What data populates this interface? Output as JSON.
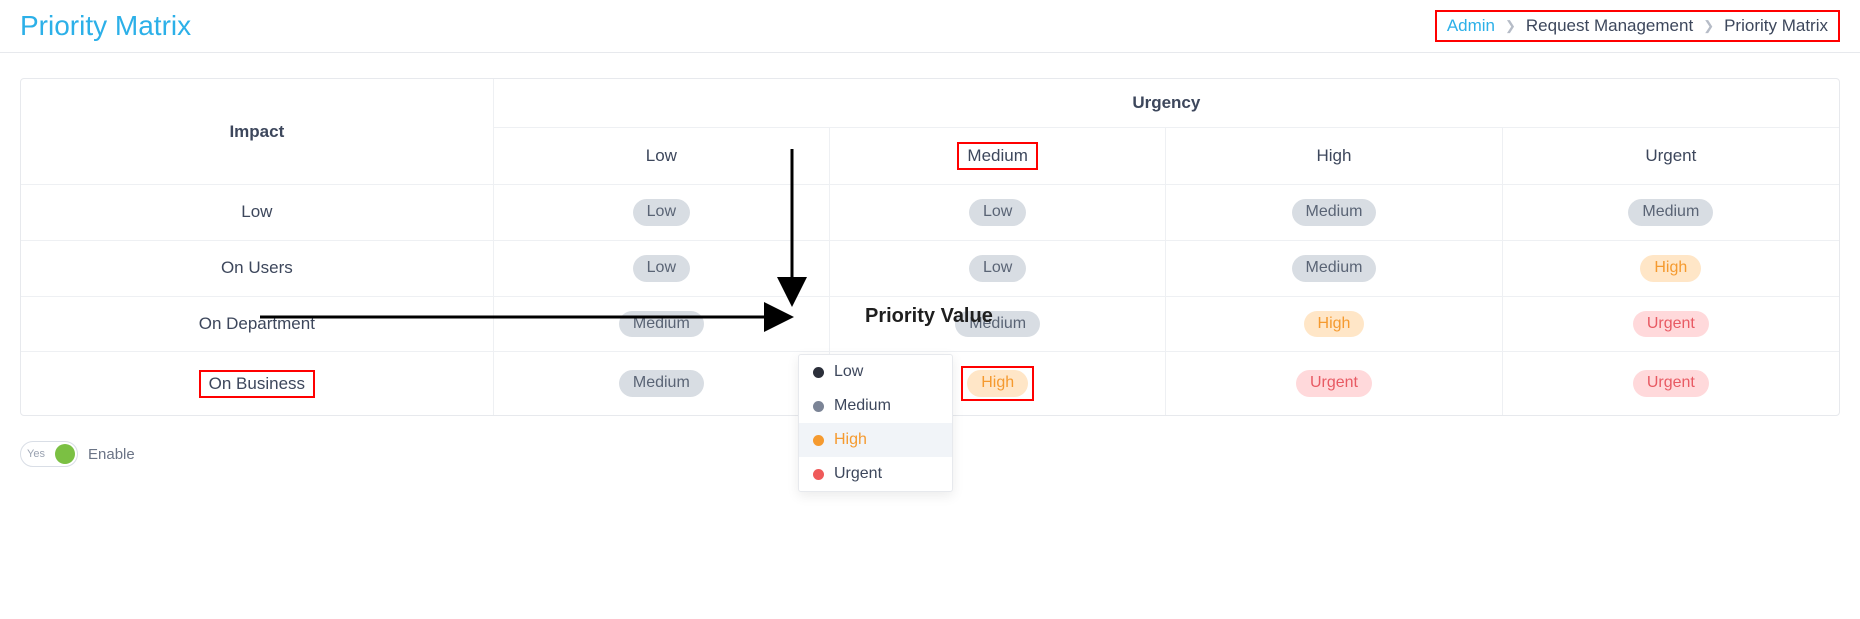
{
  "header": {
    "title": "Priority Matrix",
    "breadcrumb": {
      "admin": "Admin",
      "mid": "Request Management",
      "current": "Priority Matrix"
    }
  },
  "matrix": {
    "impact_header": "Impact",
    "urgency_header": "Urgency",
    "urgency_levels": [
      "Low",
      "Medium",
      "High",
      "Urgent"
    ],
    "rows": [
      {
        "impact": "Low",
        "cells": [
          "Low",
          "Low",
          "Medium",
          "Medium"
        ]
      },
      {
        "impact": "On Users",
        "cells": [
          "Low",
          "Low",
          "Medium",
          "High"
        ]
      },
      {
        "impact": "On Department",
        "cells": [
          "Medium",
          "Medium",
          "High",
          "Urgent"
        ]
      },
      {
        "impact": "On Business",
        "cells": [
          "Medium",
          "High",
          "Urgent",
          "Urgent"
        ]
      }
    ],
    "highlighted_urgency_index": 1,
    "highlighted_impact_index": 3,
    "selected_cell": {
      "row": 3,
      "col": 1,
      "value": "High"
    }
  },
  "dropdown": {
    "options": [
      "Low",
      "Medium",
      "High",
      "Urgent"
    ],
    "selected": "High"
  },
  "annotation": {
    "priority_value_label": "Priority Value"
  },
  "toggle": {
    "state_text": "Yes",
    "label": "Enable",
    "on": true
  }
}
